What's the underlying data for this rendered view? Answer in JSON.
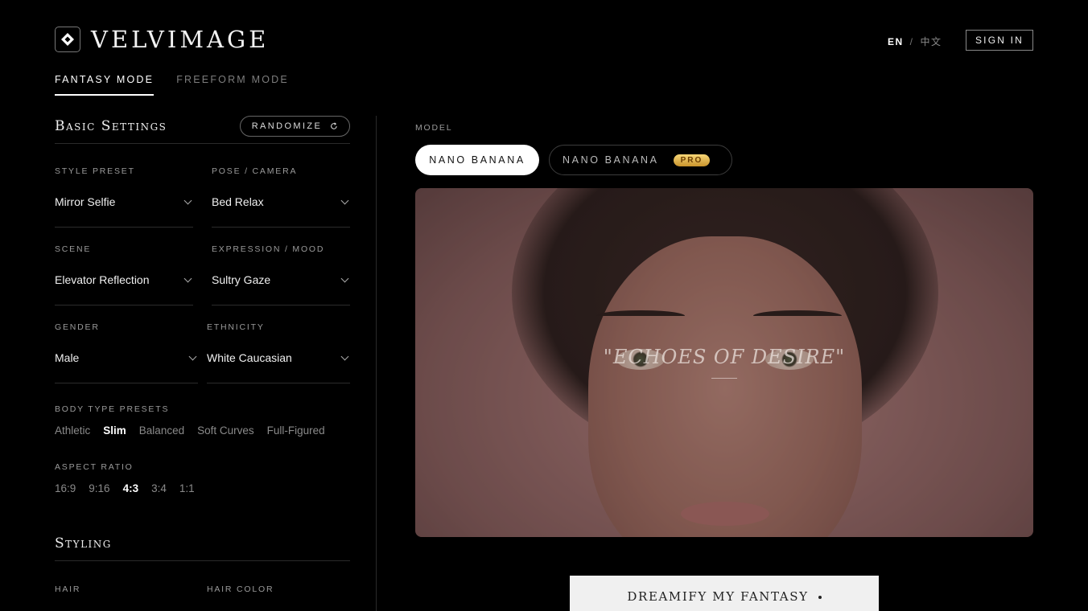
{
  "header": {
    "brand": "VELVIMAGE",
    "lang_en": "EN",
    "lang_sep": "/",
    "lang_zh": "中文",
    "sign_in": "SIGN IN"
  },
  "modes": [
    {
      "label": "FANTASY MODE",
      "active": true
    },
    {
      "label": "FREEFORM MODE",
      "active": false
    }
  ],
  "basic_settings": {
    "title": "Basic Settings",
    "randomize": "RANDOMIZE",
    "fields": {
      "style_preset": {
        "label": "STYLE PRESET",
        "value": "Mirror Selfie"
      },
      "pose_camera": {
        "label": "POSE / CAMERA",
        "value": "Bed Relax"
      },
      "scene": {
        "label": "SCENE",
        "value": "Elevator Reflection"
      },
      "expression": {
        "label": "EXPRESSION / MOOD",
        "value": "Sultry Gaze"
      },
      "gender": {
        "label": "GENDER",
        "value": "Male"
      },
      "ethnicity": {
        "label": "ETHNICITY",
        "value": "White Caucasian"
      }
    },
    "body_type": {
      "label": "BODY TYPE PRESETS",
      "options": [
        "Athletic",
        "Slim",
        "Balanced",
        "Soft Curves",
        "Full-Figured"
      ],
      "selected": "Slim"
    },
    "aspect_ratio": {
      "label": "ASPECT RATIO",
      "options": [
        "16:9",
        "9:16",
        "4:3",
        "3:4",
        "1:1"
      ],
      "selected": "4:3"
    }
  },
  "styling": {
    "title": "Styling",
    "hair_label": "HAIR",
    "hair_color_label": "HAIR COLOR"
  },
  "model": {
    "label": "MODEL",
    "options": [
      {
        "label": "NANO BANANA",
        "active": true
      },
      {
        "label": "NANO BANANA",
        "badge": "PRO",
        "active": false
      }
    ]
  },
  "preview": {
    "quote": "\"ECHOES OF DESIRE\""
  },
  "cta": {
    "label": "DREAMIFY MY FANTASY"
  },
  "colors": {
    "background": "#000000",
    "accent_pro": "#e9b949",
    "cta_bg": "#f0f0f0"
  }
}
